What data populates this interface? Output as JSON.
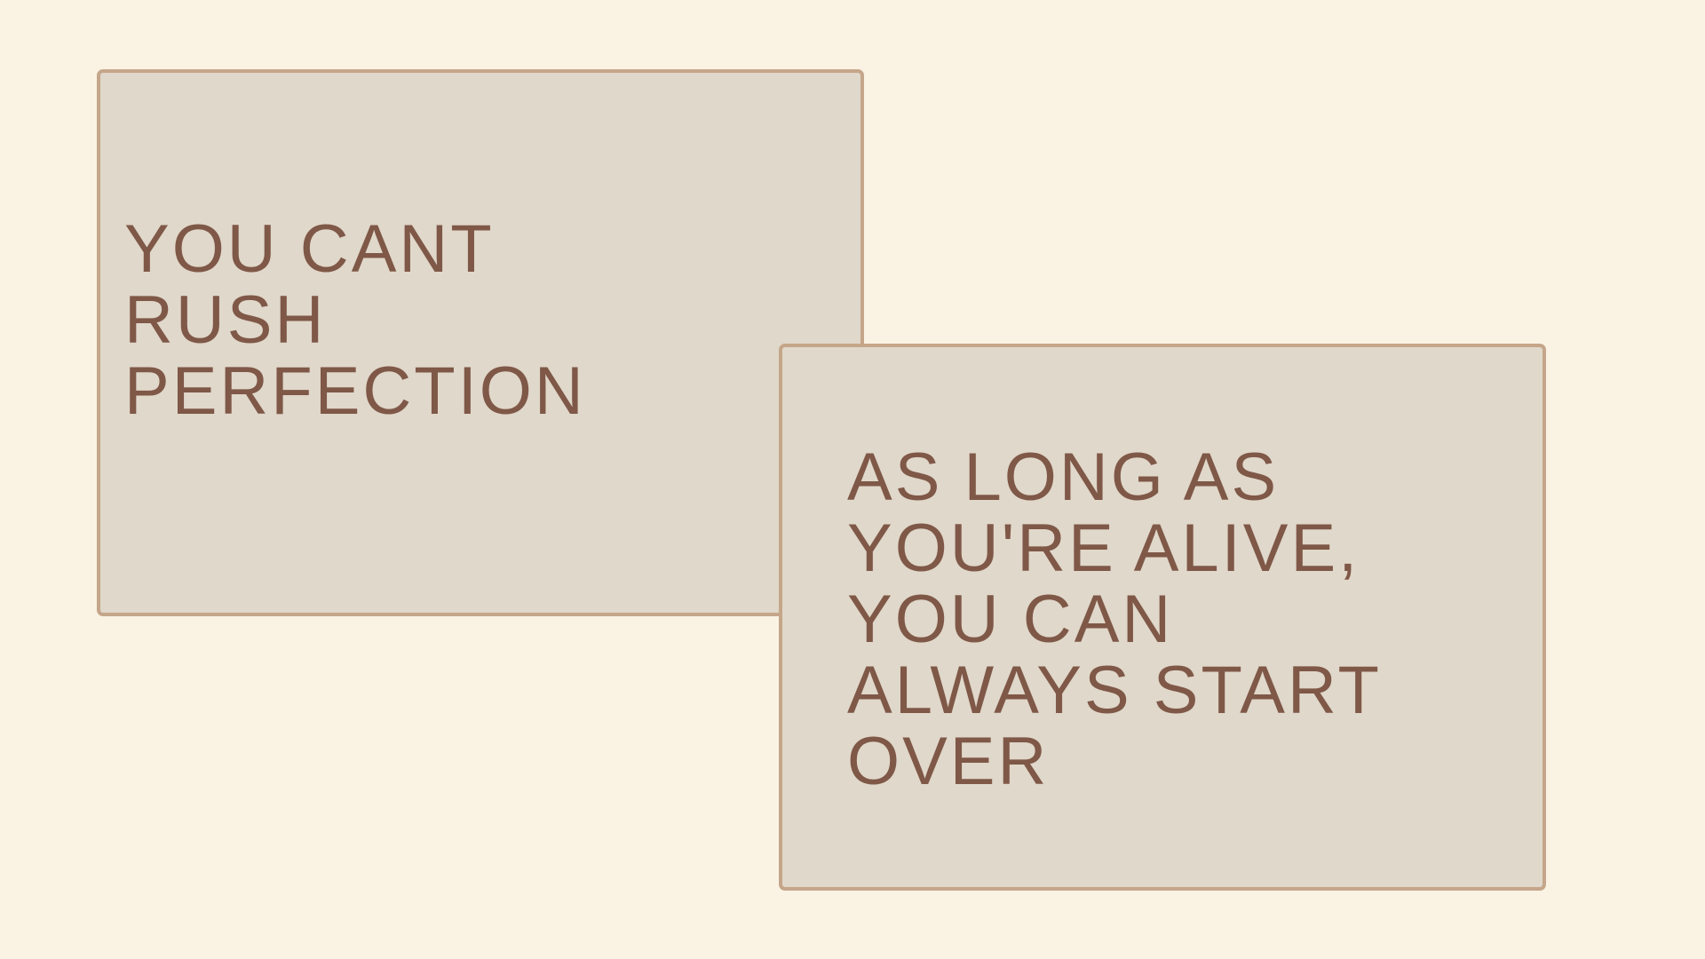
{
  "cards": [
    {
      "quote": "YOU CANT\nRUSH\nPERFECTION"
    },
    {
      "quote": "AS LONG AS\nYOU'RE ALIVE,\nYOU CAN\nALWAYS START\nOVER"
    }
  ],
  "colors": {
    "background": "#faf3e4",
    "card_fill": "#e0d8ca",
    "card_border": "#c5a68a",
    "text": "#7f5848"
  }
}
